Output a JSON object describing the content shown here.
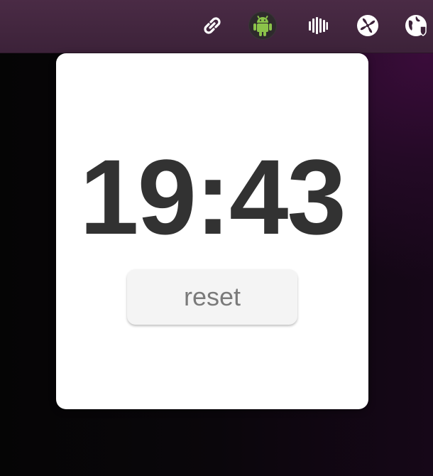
{
  "tray": {
    "icons": [
      {
        "name": "link-icon",
        "color": "#ffffff"
      },
      {
        "name": "android-icon",
        "color": "#8bc34a",
        "active": true
      },
      {
        "name": "bars-icon",
        "color": "#ffffff"
      },
      {
        "name": "fan-icon",
        "color": "#ffffff"
      },
      {
        "name": "globe-icon",
        "color": "#ffffff"
      }
    ]
  },
  "popup": {
    "time": "19:43",
    "reset_label": "reset",
    "time_color": "#323232"
  }
}
